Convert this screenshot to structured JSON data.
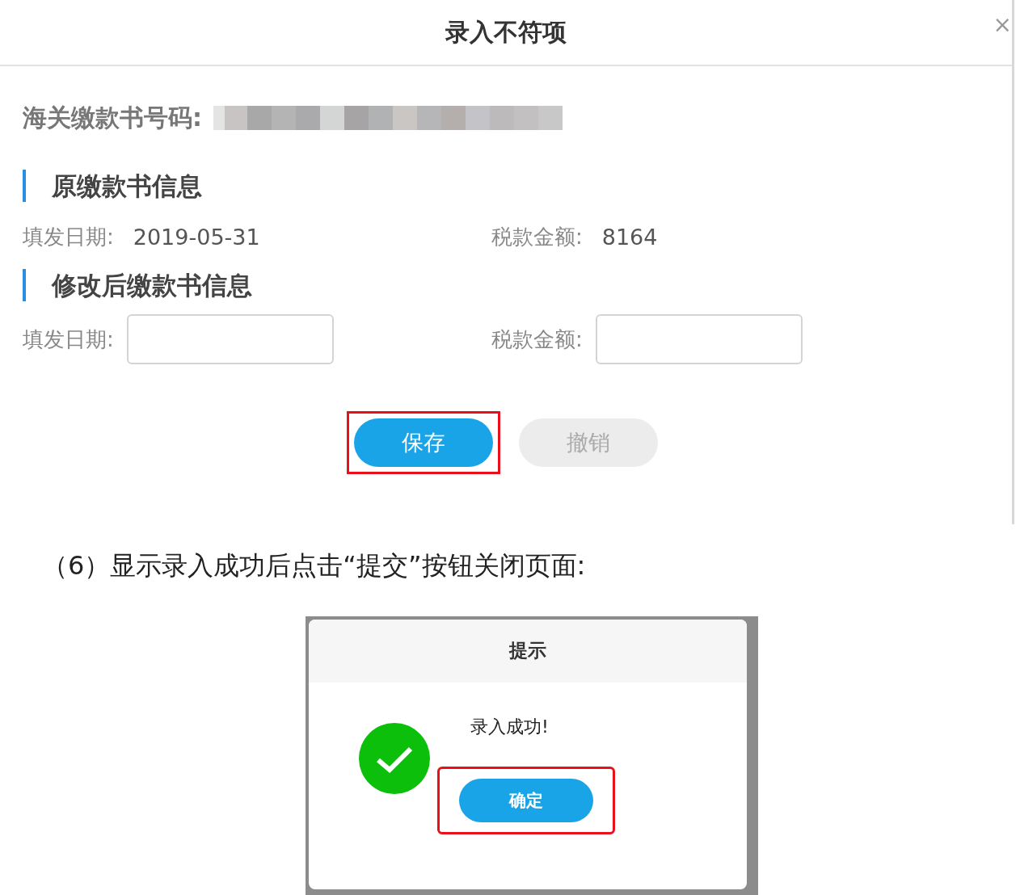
{
  "dialog": {
    "title": "录入不符项",
    "close": "×",
    "number_label": "海关缴款书号码:",
    "sections": [
      {
        "title": "原缴款书信息",
        "kind": "readonly",
        "fields": [
          {
            "label": "填发日期:",
            "value": "2019-05-31"
          },
          {
            "label": "税款金额:",
            "value": "8164"
          }
        ]
      },
      {
        "title": "修改后缴款书信息",
        "kind": "input",
        "fields": [
          {
            "label": "填发日期:"
          },
          {
            "label": "税款金额:"
          }
        ]
      }
    ],
    "buttons": [
      {
        "label": "保存",
        "kind": "primary",
        "highlighted": true
      },
      {
        "label": "撤销",
        "kind": "secondary",
        "highlighted": false
      }
    ]
  },
  "caption": "（6）显示录入成功后点击“提交”按钮关闭页面:",
  "alert": {
    "title": "提示",
    "message": "录入成功!",
    "button": {
      "label": "确定",
      "highlighted": true
    }
  }
}
